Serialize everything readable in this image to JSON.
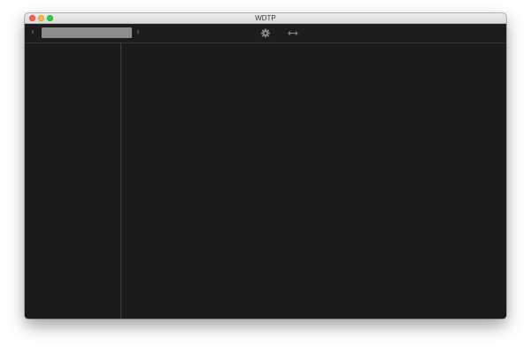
{
  "window": {
    "title": "WDTP"
  },
  "toolbar": {
    "address_value": "",
    "icons": {
      "back": "chevron-left-icon",
      "forward": "chevron-right-icon",
      "settings": "gear-icon",
      "resize": "horizontal-resize-icon"
    }
  },
  "colors": {
    "window_background": "#1b1b1b",
    "address_field": "#8d8d8d",
    "icon": "#8a8a8a",
    "divider": "#3c3c3c"
  }
}
